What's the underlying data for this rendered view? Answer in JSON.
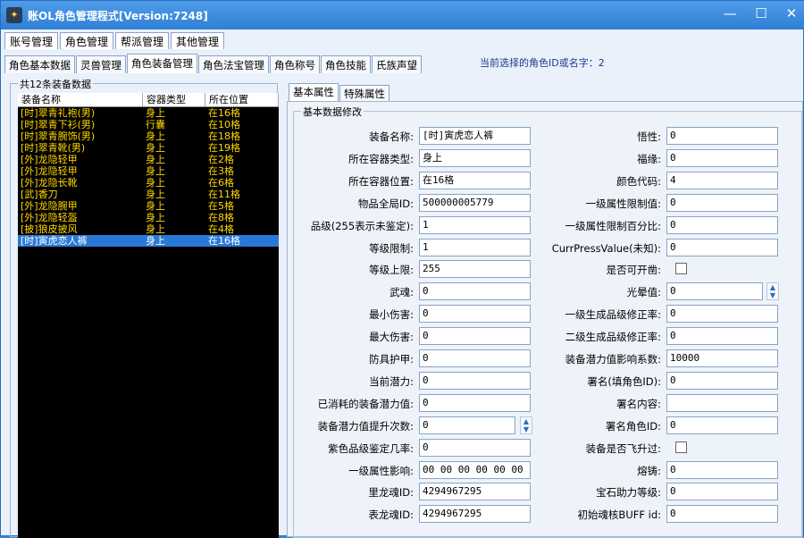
{
  "window": {
    "title": "账OL角色管理程式[Version:7248]",
    "app_icon": "app-icon",
    "controls": [
      "minimize-icon",
      "maximize-icon",
      "close-icon"
    ]
  },
  "menu": [
    "账号管理",
    "角色管理",
    "帮派管理",
    "其他管理"
  ],
  "subtabs": [
    "角色基本数据",
    "灵兽管理",
    "角色装备管理",
    "角色法宝管理",
    "角色称号",
    "角色技能",
    "氏族声望"
  ],
  "active_subtab": 2,
  "current_id_label": "当前选择的角色ID或名字：2",
  "left_group_title": "共12条装备数据",
  "list": {
    "headers": [
      "装备名称",
      "容器类型",
      "所在位置"
    ],
    "rows": [
      [
        "[时]翠青礼袍(男)",
        "身上",
        "在16格"
      ],
      [
        "[时]翠青下衫(男)",
        "行囊",
        "在10格"
      ],
      [
        "[时]翠青腕饰(男)",
        "身上",
        "在18格"
      ],
      [
        "[时]翠青靴(男)",
        "身上",
        "在19格"
      ],
      [
        "[外]龙隐轻甲",
        "身上",
        "在2格"
      ],
      [
        "[外]龙隐轻甲",
        "身上",
        "在3格"
      ],
      [
        "[外]龙隐长靴",
        "身上",
        "在6格"
      ],
      [
        "[武]香刀",
        "身上",
        "在11格"
      ],
      [
        "[外]龙隐腕甲",
        "身上",
        "在5格"
      ],
      [
        "[外]龙隐轻盔",
        "身上",
        "在8格"
      ],
      [
        "[披]狼皮披风",
        "身上",
        "在4格"
      ],
      [
        "[时]寅虎恋人裤",
        "身上",
        "在16格"
      ]
    ],
    "selected_index": 11
  },
  "right_tabs": [
    "基本属性",
    "特殊属性"
  ],
  "form_group_title": "基本数据修改",
  "left_fields": [
    {
      "label": "装备名称:",
      "value": "[时]寅虎恋人裤"
    },
    {
      "label": "所在容器类型:",
      "value": "身上"
    },
    {
      "label": "所在容器位置:",
      "value": "在16格"
    },
    {
      "label": "物品全局ID:",
      "value": "500000005779"
    },
    {
      "label": "品级(255表示未鉴定):",
      "value": "1"
    },
    {
      "label": "等级限制:",
      "value": "1"
    },
    {
      "label": "等级上限:",
      "value": "255"
    },
    {
      "label": "武魂:",
      "value": "0"
    },
    {
      "label": "最小伤害:",
      "value": "0"
    },
    {
      "label": "最大伤害:",
      "value": "0"
    },
    {
      "label": "防具护甲:",
      "value": "0"
    },
    {
      "label": "当前潜力:",
      "value": "0"
    },
    {
      "label": "已消耗的装备潜力值:",
      "value": "0"
    },
    {
      "label": "装备潜力值提升次数:",
      "value": "0"
    },
    {
      "label": "紫色品级鉴定几率:",
      "value": "0"
    },
    {
      "label": "一级属性影响:",
      "value": "00 00 00 00 00 00 00"
    },
    {
      "label": "里龙魂ID:",
      "value": "4294967295"
    },
    {
      "label": "表龙魂ID:",
      "value": "4294967295"
    }
  ],
  "right_fields": [
    {
      "label": "悟性:",
      "value": "0"
    },
    {
      "label": "福缘:",
      "value": "0"
    },
    {
      "label": "颜色代码:",
      "value": "4"
    },
    {
      "label": "一级属性限制值:",
      "value": "0"
    },
    {
      "label": "一级属性限制百分比:",
      "value": "0"
    },
    {
      "label": "CurrPressValue(未知):",
      "value": "0"
    },
    {
      "label": "是否可开凿:",
      "value": ""
    },
    {
      "label": "光晕值:",
      "value": "0"
    },
    {
      "label": "一级生成品级修正率:",
      "value": "0"
    },
    {
      "label": "二级生成品级修正率:",
      "value": "0"
    },
    {
      "label": "装备潜力值影响系数:",
      "value": "10000"
    },
    {
      "label": "署名(填角色ID):",
      "value": "0"
    },
    {
      "label": "署名内容:",
      "value": ""
    },
    {
      "label": "署名角色ID:",
      "value": "0"
    },
    {
      "label": "装备是否飞升过:",
      "value": ""
    },
    {
      "label": "熔铸:",
      "value": "0"
    },
    {
      "label": "宝石助力等级:",
      "value": "0"
    },
    {
      "label": "初始魂核BUFF id:",
      "value": "0"
    }
  ]
}
